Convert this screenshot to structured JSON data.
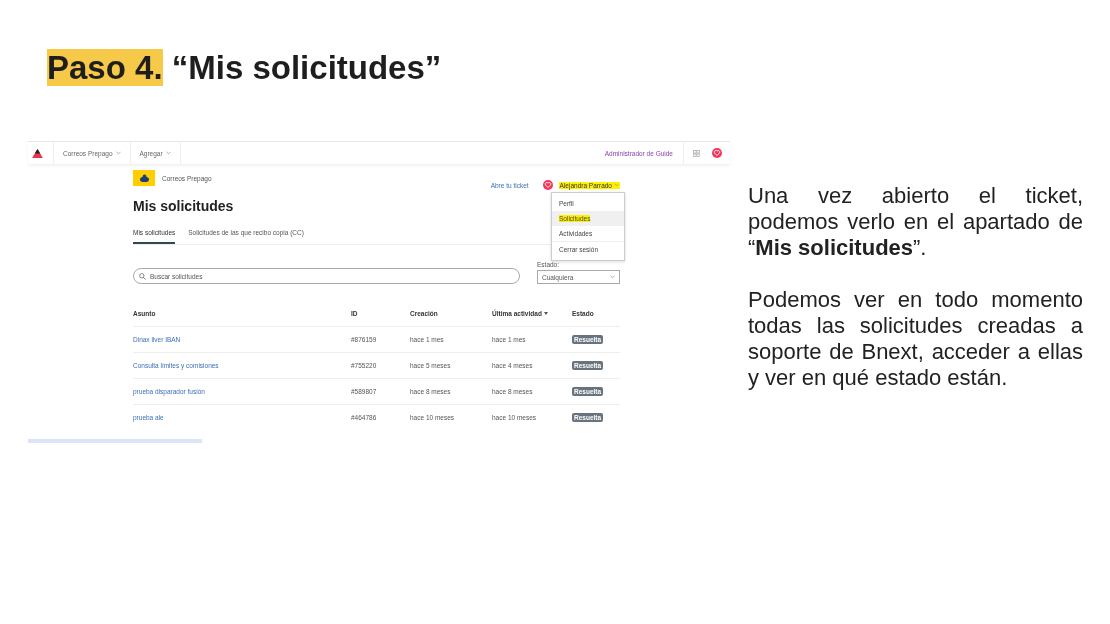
{
  "slide": {
    "title_highlight": "Paso 4.",
    "title_rest": "“Mis solicitudes”",
    "paragraphs": [
      "Una vez abierto el ticket, podemos verlo en el apartado de “**Mis solicitudes**”.",
      "Podemos ver en todo momento todas las solicitudes creadas a soporte de Bnext, acceder a ellas y ver en qué estado están."
    ]
  },
  "app": {
    "topnav": {
      "items": [
        {
          "label": "Correos Prepago"
        },
        {
          "label": "Agregar"
        }
      ],
      "admin_link": "Administrador de Guide"
    },
    "brand": "Correos Prepago",
    "header_link": "Abre tu ticket",
    "user": {
      "name": "Alejandra Parrado",
      "highlighted": true
    },
    "menu": [
      {
        "label": "Perfil",
        "selected": false,
        "highlighted": false
      },
      {
        "label": "Solicitudes",
        "selected": true,
        "highlighted": true
      },
      {
        "label": "Actividades",
        "selected": false,
        "highlighted": false
      },
      {
        "label": "Cerrar sesión",
        "selected": false,
        "highlighted": false
      }
    ],
    "heading": "Mis solicitudes",
    "tabs": [
      {
        "label": "Mis solicitudes",
        "selected": true
      },
      {
        "label": "Solicitudes de las que recibo copia (CC)",
        "selected": false
      }
    ],
    "search": {
      "placeholder": "Buscar solicitudes"
    },
    "filter": {
      "label": "Estado:",
      "value": "Cualquiera"
    },
    "table": {
      "columns": [
        {
          "label": "Asunto",
          "sorted": false
        },
        {
          "label": "ID",
          "sorted": false
        },
        {
          "label": "Creación",
          "sorted": false
        },
        {
          "label": "Última actividad",
          "sorted": true
        },
        {
          "label": "Estado",
          "sorted": false
        }
      ],
      "rows": [
        {
          "subject": "Dinax liver IBAN",
          "id": "#876159",
          "created": "hace 1 mes",
          "last_activity": "hace 1 mes",
          "status": "Resuelta"
        },
        {
          "subject": "Consulta límites y comisiones",
          "id": "#755220",
          "created": "hace 5 meses",
          "last_activity": "hace 4 meses",
          "status": "Resuelta"
        },
        {
          "subject": "prueba disparador fusión",
          "id": "#589807",
          "created": "hace 8 meses",
          "last_activity": "hace 8 meses",
          "status": "Resuelta"
        },
        {
          "subject": "prueba ale",
          "id": "#464786",
          "created": "hace 10 meses",
          "last_activity": "hace 10 meses",
          "status": "Resuelta"
        }
      ]
    }
  }
}
